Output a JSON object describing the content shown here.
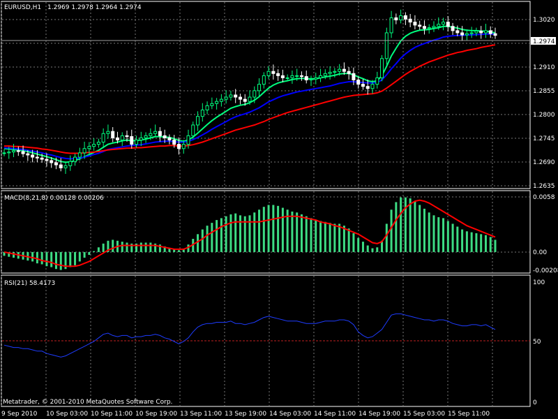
{
  "header": {
    "symbol_info": "EURUSD,H1",
    "ohlc": "1.2969 1.2978 1.2964 1.2974"
  },
  "price_label": "1.2974",
  "price_axis": [
    "1.3020",
    "1.2965",
    "1.2910",
    "1.2855",
    "1.2800",
    "1.2745",
    "1.2690",
    "1.2635"
  ],
  "macd": {
    "label": "MACD(8,21,8) 0.00128 0.00206",
    "axis": [
      "0.0058",
      "0.00",
      "-0.00208"
    ]
  },
  "rsi": {
    "label": "RSI(21) 58.4173",
    "axis": [
      "100",
      "50",
      "0"
    ]
  },
  "time_axis": [
    "9 Sep 2010",
    "10 Sep 03:00",
    "10 Sep 11:00",
    "10 Sep 19:00",
    "13 Sep 11:00",
    "13 Sep 19:00",
    "14 Sep 03:00",
    "14 Sep 11:00",
    "14 Sep 19:00",
    "15 Sep 03:00",
    "15 Sep 11:00"
  ],
  "copyright": "Metatrader, © 2001-2010 MetaQuotes Software Corp.",
  "colors": {
    "background": "#000000",
    "grid": "#7a7a7a",
    "up_candle": "#00ff7f",
    "down_candle": "#ffffff",
    "fast_ma": "#00ff7f",
    "mid_ma": "#0000ff",
    "slow_ma": "#ff0000",
    "macd_hist": "#3ddc84",
    "macd_signal": "#ff0000",
    "rsi_line": "#1e3cff",
    "rsi_level": "#c02020"
  },
  "chart_data": [
    {
      "type": "candlestick",
      "panel": "price",
      "title": "EURUSD,H1",
      "ylim": [
        1.262,
        1.305
      ],
      "x_labels": [
        "9 Sep 2010",
        "10 Sep 03:00",
        "10 Sep 11:00",
        "10 Sep 19:00",
        "13 Sep 11:00",
        "13 Sep 19:00",
        "14 Sep 03:00",
        "14 Sep 11:00",
        "14 Sep 19:00",
        "15 Sep 03:00",
        "15 Sep 11:00"
      ],
      "close": [
        1.27,
        1.2702,
        1.2705,
        1.2703,
        1.2698,
        1.2695,
        1.269,
        1.2688,
        1.2685,
        1.2682,
        1.2677,
        1.2672,
        1.2665,
        1.267,
        1.268,
        1.269,
        1.27,
        1.271,
        1.2715,
        1.272,
        1.2725,
        1.2745,
        1.275,
        1.2735,
        1.273,
        1.274,
        1.2738,
        1.272,
        1.273,
        1.2735,
        1.274,
        1.2745,
        1.275,
        1.274,
        1.2735,
        1.273,
        1.272,
        1.271,
        1.272,
        1.274,
        1.2765,
        1.2785,
        1.28,
        1.281,
        1.2815,
        1.282,
        1.2825,
        1.283,
        1.2835,
        1.283,
        1.2825,
        1.282,
        1.283,
        1.2845,
        1.286,
        1.288,
        1.289,
        1.2885,
        1.288,
        1.2875,
        1.2875,
        1.288,
        1.288,
        1.2878,
        1.287,
        1.2872,
        1.2875,
        1.288,
        1.2885,
        1.2888,
        1.289,
        1.2895,
        1.289,
        1.2885,
        1.287,
        1.286,
        1.2855,
        1.285,
        1.286,
        1.2875,
        1.292,
        1.298,
        1.3015,
        1.301,
        1.302,
        1.3012,
        1.3005,
        1.2998,
        1.2995,
        1.299,
        1.2992,
        1.2995,
        1.3,
        1.3005,
        1.2995,
        1.2985,
        1.298,
        1.2975,
        1.2978,
        1.298,
        1.2984,
        1.298,
        1.2985,
        1.2978,
        1.2974
      ],
      "series": [
        {
          "name": "fast",
          "values": [
            1.271,
            1.2709,
            1.2708,
            1.2707,
            1.2705,
            1.2703,
            1.27,
            1.2697,
            1.2694,
            1.2691,
            1.2688,
            1.2684,
            1.268,
            1.2678,
            1.2679,
            1.2682,
            1.2686,
            1.2691,
            1.2696,
            1.2701,
            1.2706,
            1.2713,
            1.272,
            1.2723,
            1.2725,
            1.2728,
            1.273,
            1.2728,
            1.2729,
            1.273,
            1.2732,
            1.2735,
            1.2738,
            1.2738,
            1.2737,
            1.2736,
            1.2733,
            1.2729,
            1.2727,
            1.273,
            1.2737,
            1.2746,
            1.2756,
            1.2766,
            1.2775,
            1.2783,
            1.279,
            1.2797,
            1.2804,
            1.2808,
            1.2811,
            1.2813,
            1.2817,
            1.2823,
            1.2831,
            1.2841,
            1.2851,
            1.2858,
            1.2863,
            1.2866,
            1.2868,
            1.2871,
            1.2873,
            1.2874,
            1.2873,
            1.2873,
            1.2873,
            1.2875,
            1.2877,
            1.2879,
            1.2881,
            1.2884,
            1.2885,
            1.2885,
            1.2882,
            1.2877,
            1.2873,
            1.2868,
            1.2866,
            1.2868,
            1.288,
            1.2902,
            1.2926,
            1.2944,
            1.2961,
            1.2972,
            1.2979,
            1.2983,
            1.2986,
            1.2987,
            1.2988,
            1.299,
            1.2992,
            1.2995,
            1.2995,
            1.2993,
            1.2991,
            1.2988,
            1.2986,
            1.2985,
            1.2985,
            1.2984,
            1.2984,
            1.2982,
            1.298
          ]
        },
        {
          "name": "mid",
          "values": [
            1.2712,
            1.2711,
            1.271,
            1.2709,
            1.2708,
            1.2706,
            1.2704,
            1.2702,
            1.27,
            1.2697,
            1.2695,
            1.2692,
            1.2689,
            1.2687,
            1.2686,
            1.2687,
            1.2688,
            1.269,
            1.2693,
            1.2696,
            1.2699,
            1.2703,
            1.2708,
            1.271,
            1.2712,
            1.2714,
            1.2716,
            1.2717,
            1.2718,
            1.2719,
            1.2721,
            1.2723,
            1.2725,
            1.2726,
            1.2727,
            1.2727,
            1.2726,
            1.2725,
            1.2725,
            1.2727,
            1.2731,
            1.2736,
            1.2742,
            1.2748,
            1.2755,
            1.2761,
            1.2767,
            1.2773,
            1.2779,
            1.2784,
            1.2788,
            1.2791,
            1.2795,
            1.28,
            1.2805,
            1.2812,
            1.2819,
            1.2824,
            1.2829,
            1.2833,
            1.2836,
            1.2839,
            1.2842,
            1.2844,
            1.2846,
            1.2848,
            1.285,
            1.2852,
            1.2854,
            1.2856,
            1.2859,
            1.2862,
            1.2864,
            1.2866,
            1.2866,
            1.2865,
            1.2864,
            1.2863,
            1.2863,
            1.2864,
            1.287,
            1.2882,
            1.2896,
            1.2908,
            1.2921,
            1.2931,
            1.2939,
            1.2946,
            1.2951,
            1.2955,
            1.2959,
            1.2963,
            1.2966,
            1.297,
            1.2972,
            1.2973,
            1.2974,
            1.2974,
            1.2975,
            1.2975,
            1.2976,
            1.2976,
            1.2977,
            1.2977,
            1.2977
          ]
        },
        {
          "name": "slow",
          "values": [
            1.2716,
            1.2716,
            1.2715,
            1.2715,
            1.2714,
            1.2713,
            1.2712,
            1.2711,
            1.2709,
            1.2708,
            1.2706,
            1.2704,
            1.2702,
            1.27,
            1.2699,
            1.2699,
            1.2699,
            1.27,
            1.2701,
            1.2702,
            1.2703,
            1.2705,
            1.2707,
            1.2708,
            1.2709,
            1.271,
            1.2711,
            1.2711,
            1.2712,
            1.2712,
            1.2713,
            1.2714,
            1.2715,
            1.2716,
            1.2716,
            1.2717,
            1.2717,
            1.2716,
            1.2716,
            1.2717,
            1.2719,
            1.2722,
            1.2725,
            1.2729,
            1.2733,
            1.2737,
            1.2741,
            1.2745,
            1.2749,
            1.2753,
            1.2756,
            1.2759,
            1.2762,
            1.2765,
            1.2769,
            1.2773,
            1.2778,
            1.2782,
            1.2786,
            1.279,
            1.2794,
            1.2797,
            1.28,
            1.2803,
            1.2806,
            1.2809,
            1.2812,
            1.2815,
            1.2818,
            1.2821,
            1.2824,
            1.2827,
            1.283,
            1.2832,
            1.2834,
            1.2835,
            1.2836,
            1.2837,
            1.2838,
            1.284,
            1.2844,
            1.2851,
            1.2859,
            1.2867,
            1.2875,
            1.2883,
            1.289,
            1.2896,
            1.2902,
            1.2907,
            1.2912,
            1.2916,
            1.292,
            1.2924,
            1.2928,
            1.2931,
            1.2934,
            1.2936,
            1.2939,
            1.2941,
            1.2943,
            1.2946,
            1.2948,
            1.295,
            1.2952
          ]
        }
      ]
    },
    {
      "type": "bar",
      "panel": "macd",
      "title": "MACD(8,21,8) 0.00128 0.00206",
      "ylim": [
        -0.00208,
        0.006
      ],
      "series": [
        {
          "name": "histogram",
          "values": [
            -0.0004,
            -0.0005,
            -0.0006,
            -0.0007,
            -0.0008,
            -0.0009,
            -0.001,
            -0.0012,
            -0.0013,
            -0.0015,
            -0.0016,
            -0.0018,
            -0.0019,
            -0.0018,
            -0.0016,
            -0.0014,
            -0.001,
            -0.0006,
            -0.0003,
            0.0001,
            0.0005,
            0.0009,
            0.0012,
            0.0013,
            0.0012,
            0.0011,
            0.001,
            0.0009,
            0.0009,
            0.001,
            0.001,
            0.001,
            0.0009,
            0.0008,
            0.0006,
            0.0004,
            0.0003,
            0.0002,
            0.0003,
            0.0008,
            0.0014,
            0.0019,
            0.0024,
            0.0028,
            0.0031,
            0.0034,
            0.0036,
            0.0038,
            0.004,
            0.0041,
            0.0039,
            0.0038,
            0.0039,
            0.0042,
            0.0045,
            0.0048,
            0.005,
            0.005,
            0.0049,
            0.0047,
            0.0045,
            0.0043,
            0.0042,
            0.004,
            0.0038,
            0.0036,
            0.0034,
            0.0033,
            0.0032,
            0.0031,
            0.003,
            0.003,
            0.0028,
            0.0025,
            0.002,
            0.0015,
            0.0011,
            0.0007,
            0.0004,
            0.0005,
            0.0012,
            0.003,
            0.0045,
            0.0053,
            0.0058,
            0.0058,
            0.0057,
            0.0054,
            0.005,
            0.0046,
            0.0042,
            0.0039,
            0.0037,
            0.0036,
            0.0033,
            0.003,
            0.0027,
            0.0024,
            0.0022,
            0.0021,
            0.002,
            0.0019,
            0.0018,
            0.0016,
            0.0013
          ]
        },
        {
          "name": "signal",
          "values": [
            0.0,
            -0.0001,
            -0.0002,
            -0.0003,
            -0.0004,
            -0.0005,
            -0.0006,
            -0.0007,
            -0.0009,
            -0.001,
            -0.0011,
            -0.0013,
            -0.0014,
            -0.0015,
            -0.0015,
            -0.0015,
            -0.0014,
            -0.0012,
            -0.001,
            -0.0007,
            -0.0004,
            -0.0001,
            0.0002,
            0.0004,
            0.0006,
            0.0007,
            0.0007,
            0.0007,
            0.0007,
            0.0007,
            0.0007,
            0.0007,
            0.0007,
            0.0006,
            0.0005,
            0.0004,
            0.0003,
            0.0003,
            0.0003,
            0.0005,
            0.0008,
            0.0011,
            0.0014,
            0.0018,
            0.0021,
            0.0024,
            0.0027,
            0.0029,
            0.0031,
            0.0032,
            0.0032,
            0.0032,
            0.0032,
            0.0032,
            0.0032,
            0.0033,
            0.0034,
            0.0035,
            0.0036,
            0.0037,
            0.0038,
            0.0038,
            0.0038,
            0.0037,
            0.0036,
            0.0035,
            0.0034,
            0.0032,
            0.0031,
            0.003,
            0.0028,
            0.0027,
            0.0025,
            0.0023,
            0.0021,
            0.0019,
            0.0016,
            0.0013,
            0.001,
            0.0009,
            0.0011,
            0.0018,
            0.0026,
            0.0034,
            0.0041,
            0.0047,
            0.0051,
            0.0054,
            0.0055,
            0.0054,
            0.0052,
            0.0049,
            0.0046,
            0.0043,
            0.004,
            0.0037,
            0.0034,
            0.0031,
            0.0028,
            0.0026,
            0.0024,
            0.0022,
            0.002,
            0.0018,
            0.0016
          ]
        }
      ]
    },
    {
      "type": "line",
      "panel": "rsi",
      "title": "RSI(21) 58.4173",
      "ylim": [
        0,
        100
      ],
      "levels": [
        50
      ],
      "series": [
        {
          "name": "RSI",
          "values": [
            47,
            46,
            45,
            45,
            44,
            44,
            43,
            42,
            42,
            40,
            39,
            38,
            37,
            38,
            40,
            42,
            44,
            46,
            48,
            50,
            53,
            56,
            57,
            55,
            54,
            55,
            55,
            53,
            54,
            54,
            55,
            55,
            56,
            55,
            53,
            52,
            50,
            48,
            50,
            53,
            58,
            62,
            64,
            65,
            65,
            66,
            66,
            66,
            67,
            65,
            65,
            64,
            65,
            66,
            68,
            70,
            71,
            70,
            69,
            68,
            67,
            67,
            67,
            66,
            65,
            65,
            65,
            66,
            67,
            67,
            67,
            68,
            68,
            67,
            64,
            58,
            55,
            53,
            54,
            57,
            60,
            66,
            72,
            73,
            73,
            72,
            71,
            70,
            69,
            68,
            68,
            67,
            68,
            68,
            67,
            65,
            64,
            63,
            63,
            64,
            64,
            63,
            64,
            62,
            60
          ]
        }
      ]
    }
  ]
}
